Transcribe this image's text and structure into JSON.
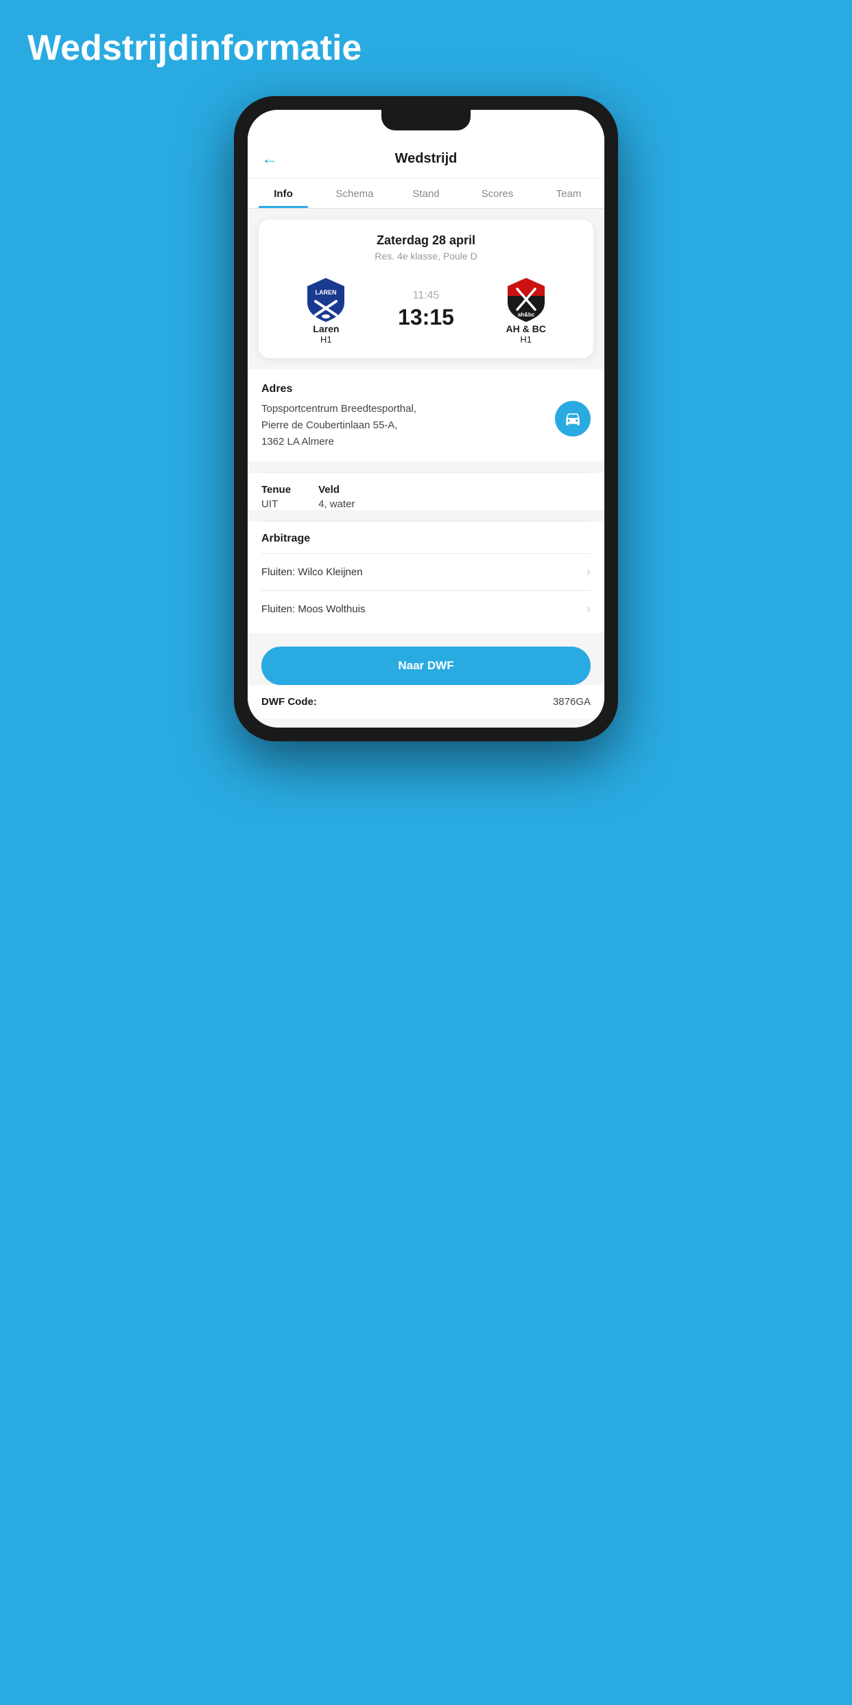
{
  "page": {
    "background_title": "Wedstrijdinformatie",
    "header": {
      "back_label": "←",
      "title": "Wedstrijd"
    },
    "tabs": [
      {
        "id": "info",
        "label": "Info",
        "active": true
      },
      {
        "id": "schema",
        "label": "Schema",
        "active": false
      },
      {
        "id": "stand",
        "label": "Stand",
        "active": false
      },
      {
        "id": "scores",
        "label": "Scores",
        "active": false
      },
      {
        "id": "team",
        "label": "Team",
        "active": false
      }
    ],
    "match": {
      "date": "Zaterdag 28 april",
      "league": "Res. 4e klasse, Poule D",
      "home_team": "Laren",
      "home_sub": "H1",
      "away_team": "AH & BC",
      "away_sub": "H1",
      "kickoff_time": "11:45",
      "score": "13:15"
    },
    "address": {
      "label": "Adres",
      "value": "Topsportcentrum Breedtesporthal,\nPierre de Coubertinlaan 55-A,\n1362 LA Almere"
    },
    "tenue": {
      "label": "Tenue",
      "value": "UIT"
    },
    "veld": {
      "label": "Veld",
      "value": "4, water"
    },
    "arbitrage": {
      "label": "Arbitrage",
      "items": [
        {
          "text": "Fluiten: Wilco Kleijnen"
        },
        {
          "text": "Fluiten: Moos Wolthuis"
        }
      ]
    },
    "dwf_button": "Naar DWF",
    "dwf_code": {
      "label": "DWF Code:",
      "value": "3876GA"
    }
  }
}
